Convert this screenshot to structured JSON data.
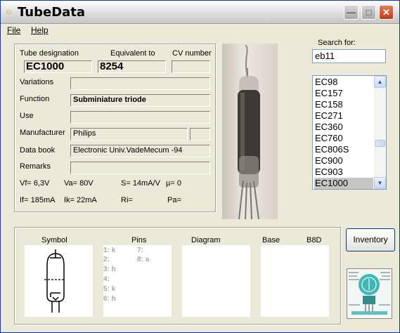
{
  "window": {
    "title": "TubeData"
  },
  "menu": {
    "file": "File",
    "help": "Help"
  },
  "details": {
    "tube_designation_label": "Tube designation",
    "tube_designation": "EC1000",
    "equivalent_label": "Equivalent to",
    "equivalent": "8254",
    "cv_label": "CV number",
    "cv_number": "",
    "variations_label": "Variations",
    "variations": "",
    "function_label": "Function",
    "function": "Subminiature triode",
    "use_label": "Use",
    "use": "",
    "manufacturer_label": "Manufacturer",
    "manufacturer": "Philips",
    "manufacturer_code": "",
    "databook_label": "Data book",
    "databook": "Electronic Univ.VadeMecum -94",
    "remarks_label": "Remarks",
    "remarks": ""
  },
  "params": {
    "vf": "Vf= 6,3V",
    "va": "Va= 80V",
    "s": "S= 14mA/V",
    "mu": "µ=    0",
    "if": "If= 185mA",
    "ik": "Ik=  22mA",
    "ri": "Ri=",
    "pa": "Pa="
  },
  "search": {
    "label": "Search for:",
    "value": "eb11"
  },
  "tube_list": {
    "items": [
      "EC98",
      "EC157",
      "EC158",
      "EC271",
      "EC360",
      "EC760",
      "EC806S",
      "EC900",
      "EC903",
      "EC1000"
    ],
    "selected": "EC1000"
  },
  "bottom": {
    "symbol_label": "Symbol",
    "pins_label": "Pins",
    "diagram_label": "Diagram",
    "base_label": "Base",
    "base_value": "B8D",
    "pins_left": [
      "1: k",
      "2:",
      "3: h",
      "4:",
      "5: k",
      "6: h"
    ],
    "pins_right": [
      "7:",
      "8: a"
    ]
  },
  "buttons": {
    "inventory": "Inventory"
  },
  "colors": {
    "title_bar": "#ececec",
    "selection": "#c6c6c6",
    "close_button": "#c23b13"
  },
  "icons": {
    "app": "lightbulb-icon",
    "minimize": "minimize-icon",
    "maximize": "maximize-icon",
    "close": "close-icon"
  }
}
